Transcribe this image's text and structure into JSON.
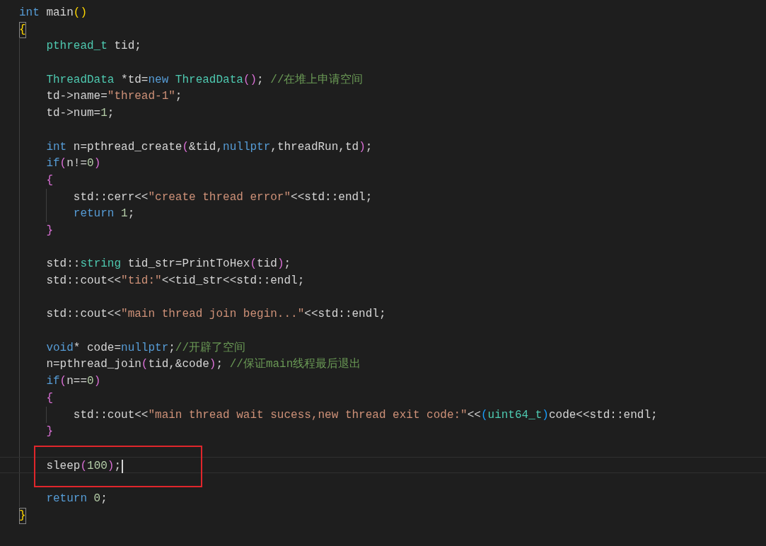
{
  "editor": {
    "lines": [
      {
        "active": false,
        "tokens": [
          {
            "kind": "keyword",
            "text": "int"
          },
          {
            "kind": "plain",
            "text": " main"
          },
          {
            "kind": "bracket1",
            "text": "()"
          }
        ]
      },
      {
        "active": false,
        "tokens": [
          {
            "kind": "bracket1",
            "text": "{",
            "matched": true
          }
        ]
      },
      {
        "active": false,
        "tokens": [
          {
            "kind": "type",
            "text": "    pthread_t"
          },
          {
            "kind": "plain",
            "text": " tid;"
          }
        ]
      },
      {
        "active": false
      },
      {
        "active": false,
        "tokens": [
          {
            "kind": "type",
            "text": "    ThreadData"
          },
          {
            "kind": "plain",
            "text": " *td="
          },
          {
            "kind": "keyword",
            "text": "new"
          },
          {
            "kind": "type",
            "text": " ThreadData"
          },
          {
            "kind": "bracket2",
            "text": "()"
          },
          {
            "kind": "plain",
            "text": "; "
          },
          {
            "kind": "comment",
            "text": "//在堆上申请空间"
          }
        ]
      },
      {
        "active": false,
        "tokens": [
          {
            "kind": "plain",
            "text": "    td->name="
          },
          {
            "kind": "string",
            "text": "\"thread-1\""
          },
          {
            "kind": "plain",
            "text": ";"
          }
        ]
      },
      {
        "active": false,
        "tokens": [
          {
            "kind": "plain",
            "text": "    td->num="
          },
          {
            "kind": "number",
            "text": "1"
          },
          {
            "kind": "plain",
            "text": ";"
          }
        ]
      },
      {
        "active": false
      },
      {
        "active": false,
        "tokens": [
          {
            "kind": "keyword",
            "text": "    int"
          },
          {
            "kind": "plain",
            "text": " n=pthread_create"
          },
          {
            "kind": "bracket2",
            "text": "("
          },
          {
            "kind": "plain",
            "text": "&tid,"
          },
          {
            "kind": "keyword",
            "text": "nullptr"
          },
          {
            "kind": "plain",
            "text": ",threadRun,td"
          },
          {
            "kind": "bracket2",
            "text": ")"
          },
          {
            "kind": "plain",
            "text": ";"
          }
        ]
      },
      {
        "active": false,
        "tokens": [
          {
            "kind": "keyword",
            "text": "    if"
          },
          {
            "kind": "bracket2",
            "text": "("
          },
          {
            "kind": "plain",
            "text": "n!="
          },
          {
            "kind": "number",
            "text": "0"
          },
          {
            "kind": "bracket2",
            "text": ")"
          }
        ]
      },
      {
        "active": false,
        "tokens": [
          {
            "kind": "bracket2",
            "text": "    {"
          }
        ]
      },
      {
        "active": false,
        "tokens": [
          {
            "kind": "plain",
            "text": "        std::cerr<<"
          },
          {
            "kind": "string",
            "text": "\"create thread error\""
          },
          {
            "kind": "plain",
            "text": "<<std::endl;"
          }
        ]
      },
      {
        "active": false,
        "tokens": [
          {
            "kind": "keyword",
            "text": "        return"
          },
          {
            "kind": "number",
            "text": " 1"
          },
          {
            "kind": "plain",
            "text": ";"
          }
        ]
      },
      {
        "active": false,
        "tokens": [
          {
            "kind": "bracket2",
            "text": "    }"
          }
        ]
      },
      {
        "active": false
      },
      {
        "active": false,
        "tokens": [
          {
            "kind": "plain",
            "text": "    std::"
          },
          {
            "kind": "type",
            "text": "string"
          },
          {
            "kind": "plain",
            "text": " tid_str=PrintToHex"
          },
          {
            "kind": "bracket2",
            "text": "("
          },
          {
            "kind": "plain",
            "text": "tid"
          },
          {
            "kind": "bracket2",
            "text": ")"
          },
          {
            "kind": "plain",
            "text": ";"
          }
        ]
      },
      {
        "active": false,
        "tokens": [
          {
            "kind": "plain",
            "text": "    std::cout<<"
          },
          {
            "kind": "string",
            "text": "\"tid:\""
          },
          {
            "kind": "plain",
            "text": "<<tid_str<<std::endl;"
          }
        ]
      },
      {
        "active": false
      },
      {
        "active": false,
        "tokens": [
          {
            "kind": "plain",
            "text": "    std::cout<<"
          },
          {
            "kind": "string",
            "text": "\"main thread join begin...\""
          },
          {
            "kind": "plain",
            "text": "<<std::endl;"
          }
        ]
      },
      {
        "active": false
      },
      {
        "active": false,
        "tokens": [
          {
            "kind": "keyword",
            "text": "    void"
          },
          {
            "kind": "plain",
            "text": "* code="
          },
          {
            "kind": "keyword",
            "text": "nullptr"
          },
          {
            "kind": "plain",
            "text": ";"
          },
          {
            "kind": "comment",
            "text": "//开辟了空间"
          }
        ]
      },
      {
        "active": false,
        "tokens": [
          {
            "kind": "plain",
            "text": "    n=pthread_join"
          },
          {
            "kind": "bracket2",
            "text": "("
          },
          {
            "kind": "plain",
            "text": "tid,&code"
          },
          {
            "kind": "bracket2",
            "text": ")"
          },
          {
            "kind": "plain",
            "text": "; "
          },
          {
            "kind": "comment",
            "text": "//保证main线程最后退出"
          }
        ]
      },
      {
        "active": false,
        "tokens": [
          {
            "kind": "keyword",
            "text": "    if"
          },
          {
            "kind": "bracket2",
            "text": "("
          },
          {
            "kind": "plain",
            "text": "n=="
          },
          {
            "kind": "number",
            "text": "0"
          },
          {
            "kind": "bracket2",
            "text": ")"
          }
        ]
      },
      {
        "active": false,
        "tokens": [
          {
            "kind": "bracket2",
            "text": "    {"
          }
        ]
      },
      {
        "active": false,
        "tokens": [
          {
            "kind": "plain",
            "text": "        std::cout<<"
          },
          {
            "kind": "string",
            "text": "\"main thread wait sucess,new thread exit code:\""
          },
          {
            "kind": "plain",
            "text": "<<"
          },
          {
            "kind": "bracket3",
            "text": "("
          },
          {
            "kind": "type",
            "text": "uint64_t"
          },
          {
            "kind": "bracket3",
            "text": ")"
          },
          {
            "kind": "plain",
            "text": "code<<std::endl;"
          }
        ]
      },
      {
        "active": false,
        "tokens": [
          {
            "kind": "bracket2",
            "text": "    }"
          }
        ]
      },
      {
        "active": false
      },
      {
        "active": true,
        "boxed": true,
        "tokens": [
          {
            "kind": "plain",
            "text": "    sleep"
          },
          {
            "kind": "bracket2",
            "text": "("
          },
          {
            "kind": "number",
            "text": "100"
          },
          {
            "kind": "bracket2",
            "text": ")"
          },
          {
            "kind": "plain",
            "text": ";"
          }
        ]
      },
      {
        "active": false
      },
      {
        "active": false,
        "tokens": [
          {
            "kind": "keyword",
            "text": "    return"
          },
          {
            "kind": "number",
            "text": " 0"
          },
          {
            "kind": "plain",
            "text": ";"
          }
        ]
      },
      {
        "active": false,
        "tokens": [
          {
            "kind": "bracket1",
            "text": "}",
            "matched": true
          }
        ]
      }
    ]
  }
}
